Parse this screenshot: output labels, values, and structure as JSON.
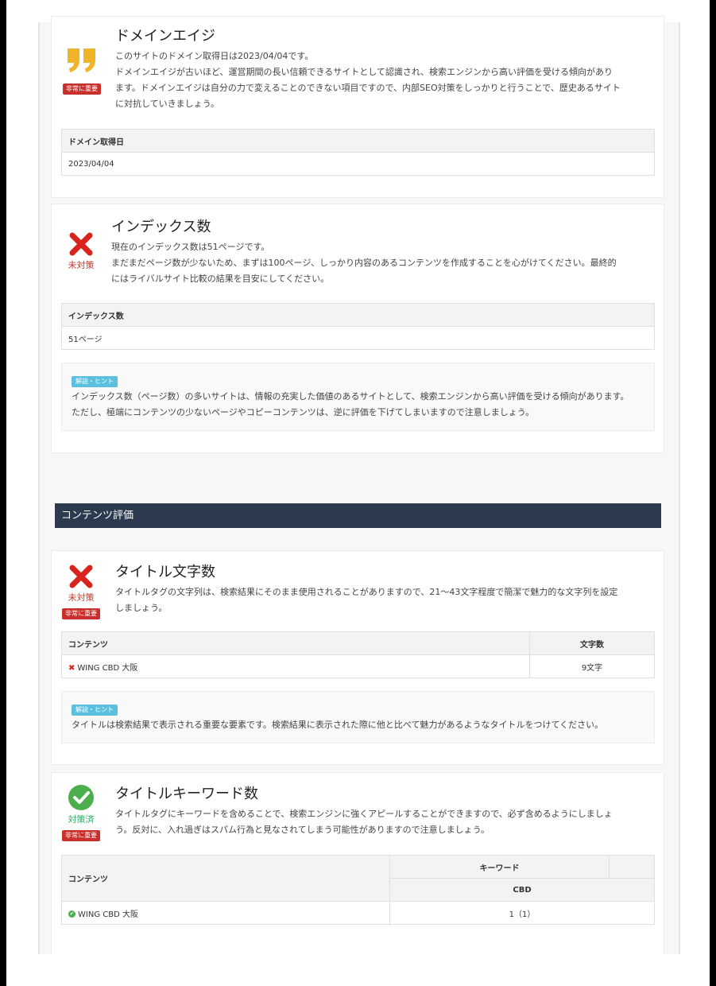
{
  "colors": {
    "critical_label": "#c9302c",
    "hint_label": "#5bc0de",
    "section_bar": "#2b3a4e",
    "ng": "#d9241c",
    "ok": "#4cae4c",
    "quote": "#f0b429"
  },
  "domain_age": {
    "title": "ドメインエイジ",
    "icon": "quote-icon",
    "label": "非常に重要",
    "desc_lines": [
      "このサイトのドメイン取得日は2023/04/04です。",
      "ドメインエイジが古いほど、運営期間の長い信頼できるサイトとして認識され、検索エンジンから高い評価を受ける傾向があり",
      "ます。ドメインエイジは自分の力で変えることのできない項目ですので、内部SEO対策をしっかりと行うことで、歴史あるサイト",
      "に対抗していきましょう。"
    ],
    "table_header": "ドメイン取得日",
    "table_value": "2023/04/04"
  },
  "index_count": {
    "title": "インデックス数",
    "status": "未対策",
    "desc_lines": [
      "現在のインデックス数は51ページです。",
      "まだまだページ数が少ないため、まずは100ページ、しっかり内容のあるコンテンツを作成することを心がけてください。最終的",
      "にはライバルサイト比較の結果を目安にしてください。"
    ],
    "table_header": "インデックス数",
    "table_value": "51ページ",
    "hint_label": "解説・ヒント",
    "hint_lines": [
      "インデックス数（ページ数）の多いサイトは、情報の充実した価値のあるサイトとして、検索エンジンから高い評価を受ける傾向があります。",
      "ただし、極端にコンテンツの少ないページやコピーコンテンツは、逆に評価を下げてしまいますので注意しましょう。"
    ]
  },
  "section": {
    "title": "コンテンツ評価"
  },
  "title_length": {
    "title": "タイトル文字数",
    "status": "未対策",
    "label": "非常に重要",
    "desc_lines": [
      "タイトルタグの文字列は、検索結果にそのまま使用されることがありますので、21〜43文字程度で簡潔で魅力的な文字列を設定",
      "しましょう。"
    ],
    "col_content": "コンテンツ",
    "col_count": "文字数",
    "row_content": "WING CBD 大阪",
    "row_count": "9文字",
    "hint_label": "解説・ヒント",
    "hint_lines": [
      "タイトルは検索結果で表示される重要な要素です。検索結果に表示された際に他と比べて魅力があるようなタイトルをつけてください。"
    ]
  },
  "title_keywords": {
    "title": "タイトルキーワード数",
    "status": "対策済",
    "label": "非常に重要",
    "desc_lines": [
      "タイトルタグにキーワードを含めることで、検索エンジンに強くアピールすることができますので、必ず含めるようにしましょ",
      "う。反対に、入れ過ぎはスパム行為と見なされてしまう可能性がありますので注意しましょう。"
    ],
    "col_content": "コンテンツ",
    "col_keyword": "キーワード",
    "col_kw_name": "CBD",
    "row_content": "WING CBD 大阪",
    "row_value": "1（1）"
  }
}
